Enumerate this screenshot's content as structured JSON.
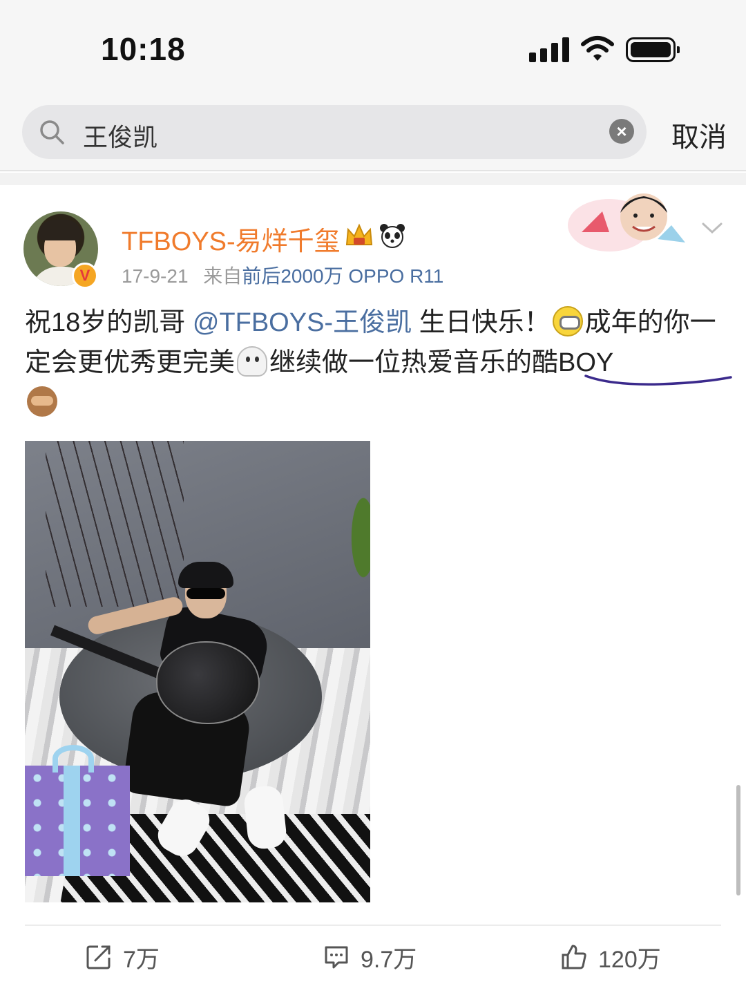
{
  "status_bar": {
    "time": "10:18"
  },
  "search": {
    "query": "王俊凯",
    "cancel_label": "取消"
  },
  "post": {
    "author": "TFBOYS-易烊千玺",
    "badge_letter": "V",
    "date": "17-9-21",
    "source_prefix": "来自",
    "source": "前后2000万 OPPO R11",
    "text_part1": "祝18岁的凯哥 ",
    "mention": "@TFBOYS-王俊凯",
    "text_part2": " 生日快乐！",
    "text_part3": "成年的你一定会更优秀更完美",
    "text_part4": "继续做一位热爱音乐的酷BOY"
  },
  "actions": {
    "repost_count": "7万",
    "comment_count": "9.7万",
    "like_count": "120万"
  },
  "icons": {
    "repost": "share-icon",
    "comment": "comment-icon",
    "like": "thumbs-up-icon"
  },
  "colors": {
    "author": "#f07b2c",
    "mention": "#4a6ea0",
    "underline": "#3b2a8c"
  }
}
